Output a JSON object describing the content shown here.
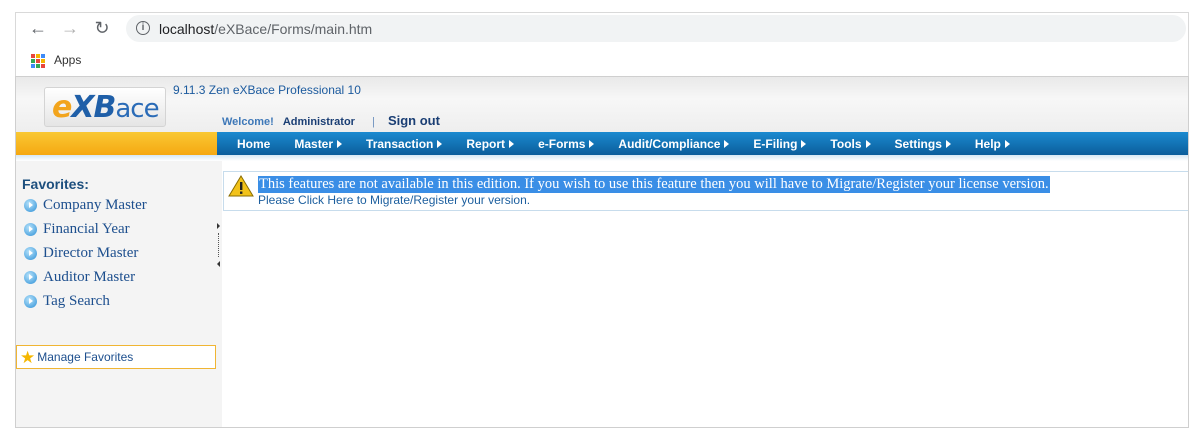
{
  "browser": {
    "url_host": "localhost",
    "url_path": "/eXBace/Forms/main.htm",
    "bookmarks": [
      {
        "label": "Apps"
      }
    ]
  },
  "header": {
    "logo_e": "e",
    "logo_xb": "XB",
    "logo_ace": "ace",
    "product_title": "9.11.3 Zen eXBace Professional 10",
    "welcome_label": "Welcome!",
    "user_name": "Administrator",
    "separator": "|",
    "signout_label": "Sign out"
  },
  "menu": {
    "items": [
      {
        "label": "Home",
        "has_submenu": false
      },
      {
        "label": "Master",
        "has_submenu": true
      },
      {
        "label": "Transaction",
        "has_submenu": true
      },
      {
        "label": "Report",
        "has_submenu": true
      },
      {
        "label": "e-Forms",
        "has_submenu": true
      },
      {
        "label": "Audit/Compliance",
        "has_submenu": true
      },
      {
        "label": "E-Filing",
        "has_submenu": true
      },
      {
        "label": "Tools",
        "has_submenu": true
      },
      {
        "label": "Settings",
        "has_submenu": true
      },
      {
        "label": "Help",
        "has_submenu": true
      }
    ]
  },
  "sidebar": {
    "heading": "Favorites:",
    "items": [
      {
        "label": "Company Master"
      },
      {
        "label": "Financial Year"
      },
      {
        "label": "Director Master"
      },
      {
        "label": "Auditor Master"
      },
      {
        "label": "Tag Search"
      }
    ],
    "manage_label": "Manage Favorites"
  },
  "notice": {
    "line1": "This features are not available in this edition. If you wish to use this feature then you will have to Migrate/Register your license version.",
    "line2": "Please Click Here to Migrate/Register your version."
  },
  "colors": {
    "menu_blue": "#0b6fb5",
    "menu_gold": "#f5a812",
    "link_blue": "#1d4f8e",
    "selection": "#3a8ee6"
  }
}
